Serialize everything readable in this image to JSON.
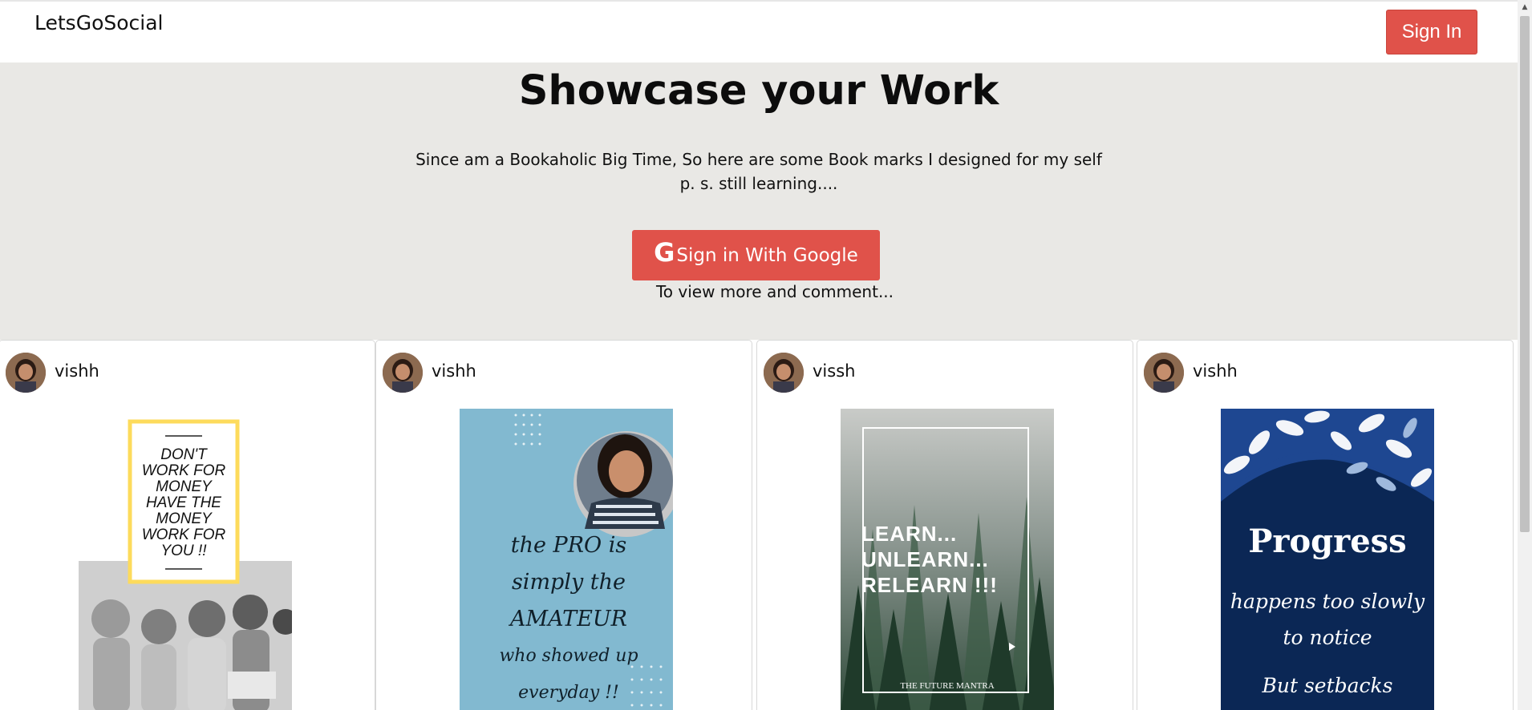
{
  "navbar": {
    "brand": "LetsGoSocial",
    "sign_in_label": "Sign In"
  },
  "hero": {
    "title": "Showcase your Work",
    "description_line1": "Since am a Bookaholic Big Time, So here are some Book marks I designed for my self",
    "description_line2": "p. s. still learning....",
    "google_icon": "G",
    "google_button_label": "Sign in With Google",
    "google_note": "To view more and comment..."
  },
  "posts": [
    {
      "username": "vishh",
      "poster": {
        "lines": [
          "DON'T",
          "WORK FOR",
          "MONEY",
          "HAVE THE",
          "MONEY",
          "WORK FOR",
          "YOU !!"
        ]
      }
    },
    {
      "username": "vishh",
      "poster": {
        "lines": [
          "the PRO is",
          "simply the",
          "AMATEUR",
          "who showed up",
          "everyday !!"
        ]
      }
    },
    {
      "username": "vissh",
      "poster": {
        "lines": [
          "LEARN...",
          "UNLEARN...",
          "RELEARN !!!"
        ],
        "footer": "THE FUTURE MANTRA"
      }
    },
    {
      "username": "vishh",
      "poster": {
        "title": "Progress",
        "lines": [
          "happens too slowly",
          "to notice",
          "But setbacks"
        ]
      }
    }
  ],
  "colors": {
    "accent": "#e0524a",
    "hero_bg": "#e9e8e5",
    "poster2_bg": "#82b9d0",
    "poster4_bg": "#0b2755"
  }
}
